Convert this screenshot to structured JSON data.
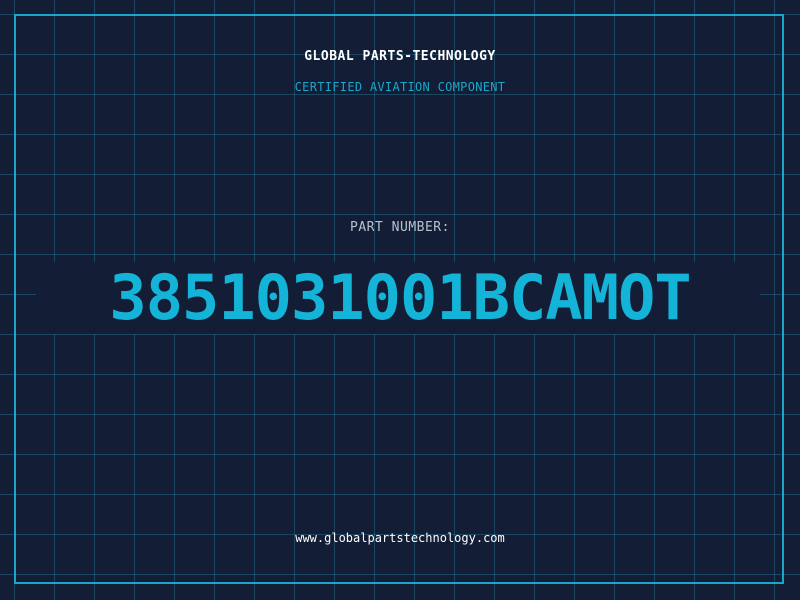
{
  "header": {
    "company": "GLOBAL PARTS-TECHNOLOGY",
    "subtitle": "CERTIFIED AVIATION COMPONENT"
  },
  "part": {
    "label": "PART NUMBER:",
    "number": "3851031001BCAMOT"
  },
  "footer": {
    "website": "www.globalpartstechnology.com"
  },
  "colors": {
    "background": "#131d35",
    "grid": "#28789a",
    "accent": "#1aa6c9",
    "part_number": "#14b4d8"
  }
}
